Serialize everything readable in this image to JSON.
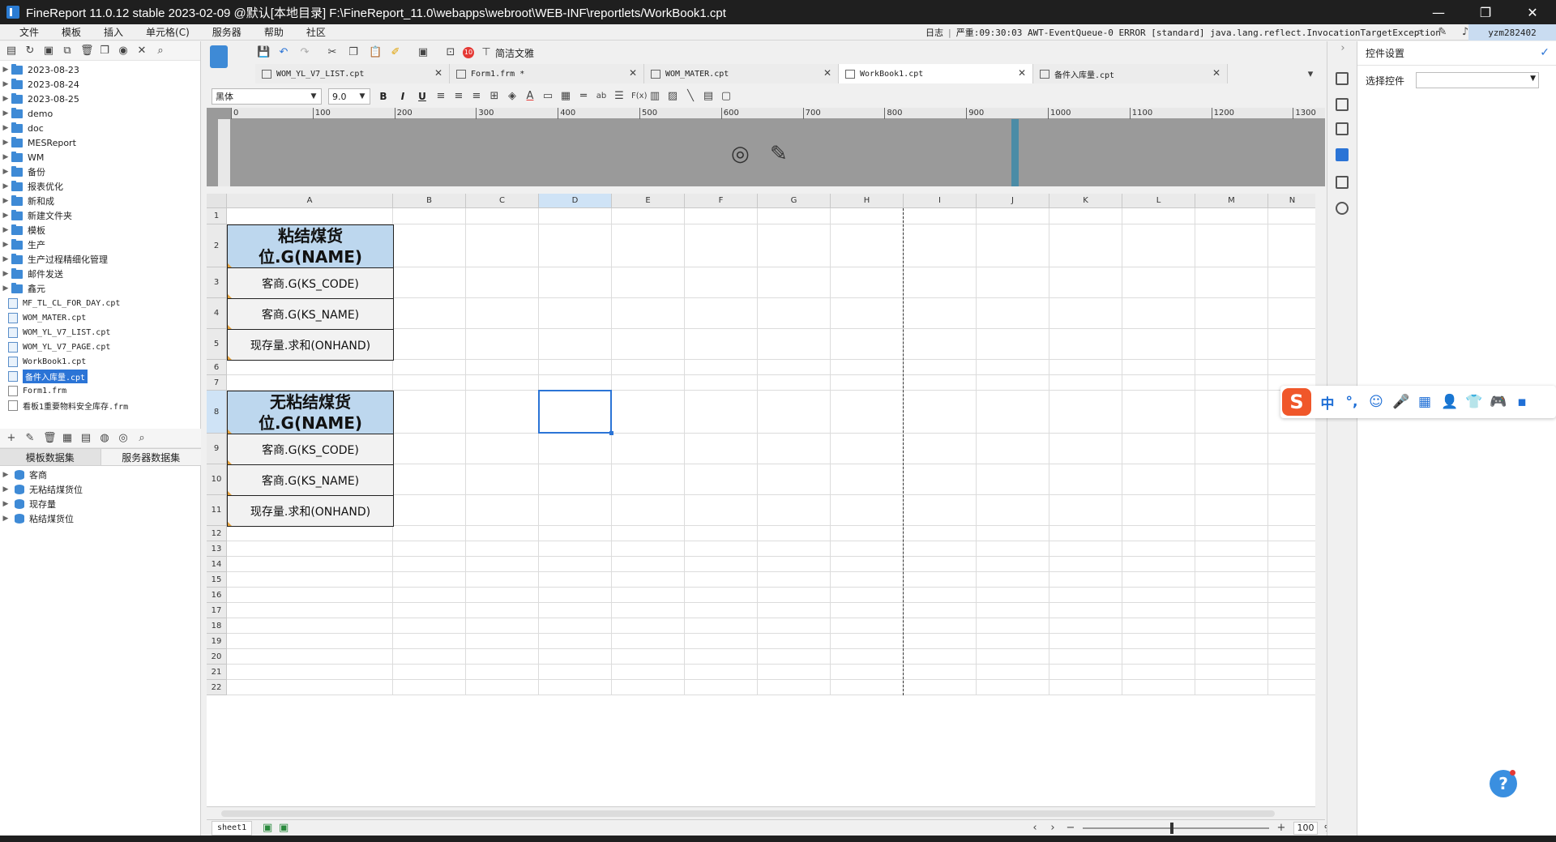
{
  "window": {
    "title": "FineReport 11.0.12 stable 2023-02-09 @默认[本地目录]   F:\\FineReport_11.0\\webapps\\webroot\\WEB-INF\\reportlets/WorkBook1.cpt",
    "minimize": "—",
    "maximize": "❐",
    "close": "✕"
  },
  "menu": {
    "items": [
      "文件",
      "模板",
      "插入",
      "单元格(C)",
      "服务器",
      "帮助",
      "社区"
    ],
    "log_label": "日志",
    "log_message": "严重:09:30:03 AWT-EventQueue-0 ERROR [standard] java.lang.reflect.InvocationTargetException",
    "user": "yzm282402"
  },
  "left_panel": {
    "tree": [
      {
        "type": "folder",
        "label": "2023-08-23"
      },
      {
        "type": "folder",
        "label": "2023-08-24"
      },
      {
        "type": "folder",
        "label": "2023-08-25"
      },
      {
        "type": "folder",
        "label": "demo"
      },
      {
        "type": "folder",
        "label": "doc"
      },
      {
        "type": "folder",
        "label": "MESReport"
      },
      {
        "type": "folder",
        "label": "WM"
      },
      {
        "type": "folder",
        "label": "备份"
      },
      {
        "type": "folder",
        "label": "报表优化"
      },
      {
        "type": "folder",
        "label": "新和成"
      },
      {
        "type": "folder",
        "label": "新建文件夹"
      },
      {
        "type": "folder",
        "label": "模板"
      },
      {
        "type": "folder",
        "label": "生产"
      },
      {
        "type": "folder",
        "label": "生产过程精细化管理"
      },
      {
        "type": "folder",
        "label": "邮件发送"
      },
      {
        "type": "folder",
        "label": "鑫元"
      },
      {
        "type": "cpt",
        "label": "MF_TL_CL_FOR_DAY.cpt"
      },
      {
        "type": "cpt",
        "label": "WOM_MATER.cpt"
      },
      {
        "type": "cpt",
        "label": "WOM_YL_V7_LIST.cpt"
      },
      {
        "type": "cpt",
        "label": "WOM_YL_V7_PAGE.cpt"
      },
      {
        "type": "cpt",
        "label": "WorkBook1.cpt"
      },
      {
        "type": "cpt",
        "label": "备件入库量.cpt",
        "selected": true
      },
      {
        "type": "frm",
        "label": "Form1.frm"
      },
      {
        "type": "frm",
        "label": "看板1重要物料安全库存.frm"
      }
    ],
    "ds_tabs": [
      "模板数据集",
      "服务器数据集"
    ],
    "datasets": [
      "客商",
      "无粘结煤货位",
      "现存量",
      "粘结煤货位"
    ]
  },
  "toolbar": {
    "simplify_label": "简洁文雅",
    "font_name": "黑体",
    "font_size": "9.0",
    "bold": "B",
    "italic": "I",
    "underline": "U"
  },
  "tabs": [
    {
      "label": "WOM_YL_V7_LIST.cpt",
      "active": false
    },
    {
      "label": "Form1.frm *",
      "active": false
    },
    {
      "label": "WOM_MATER.cpt",
      "active": false
    },
    {
      "label": "WorkBook1.cpt",
      "active": true
    },
    {
      "label": "备件入库量.cpt",
      "active": false
    }
  ],
  "ruler": [
    "0",
    "100",
    "200",
    "300",
    "400",
    "500",
    "600",
    "700",
    "800",
    "900",
    "1000",
    "1100",
    "1200",
    "1300"
  ],
  "sheet": {
    "columns": [
      "A",
      "B",
      "C",
      "D",
      "E",
      "F",
      "G",
      "H",
      "I",
      "J",
      "K",
      "L",
      "M",
      "N"
    ],
    "rows": [
      "1",
      "2",
      "3",
      "4",
      "5",
      "6",
      "7",
      "8",
      "9",
      "10",
      "11",
      "12",
      "13",
      "14",
      "15",
      "16",
      "17",
      "18",
      "19",
      "20",
      "21",
      "22"
    ],
    "cells": {
      "a2": "粘结煤货位.G(NAME)",
      "a3": "客商.G(KS_CODE)",
      "a4": "客商.G(KS_NAME)",
      "a5": "现存量.求和(ONHAND)",
      "a8": "无粘结煤货位.G(NAME)",
      "a9": "客商.G(KS_CODE)",
      "a10": "客商.G(KS_NAME)",
      "a11": "现存量.求和(ONHAND)"
    },
    "sheet_tab": "sheet1",
    "zoom": "100",
    "zoom_unit": "%"
  },
  "right_panel": {
    "title": "控件设置",
    "select_label": "选择控件",
    "select_value": ""
  },
  "ime": {
    "items": [
      "中",
      "°,",
      "☺",
      "🎤",
      "▦",
      "👤",
      "👕",
      "🎮",
      "▪"
    ]
  },
  "help": {
    "label": "?"
  },
  "colors": {
    "accent": "#2b74d6",
    "header_fill": "#bdd7ee",
    "cell_fill": "#f2f2f2"
  }
}
